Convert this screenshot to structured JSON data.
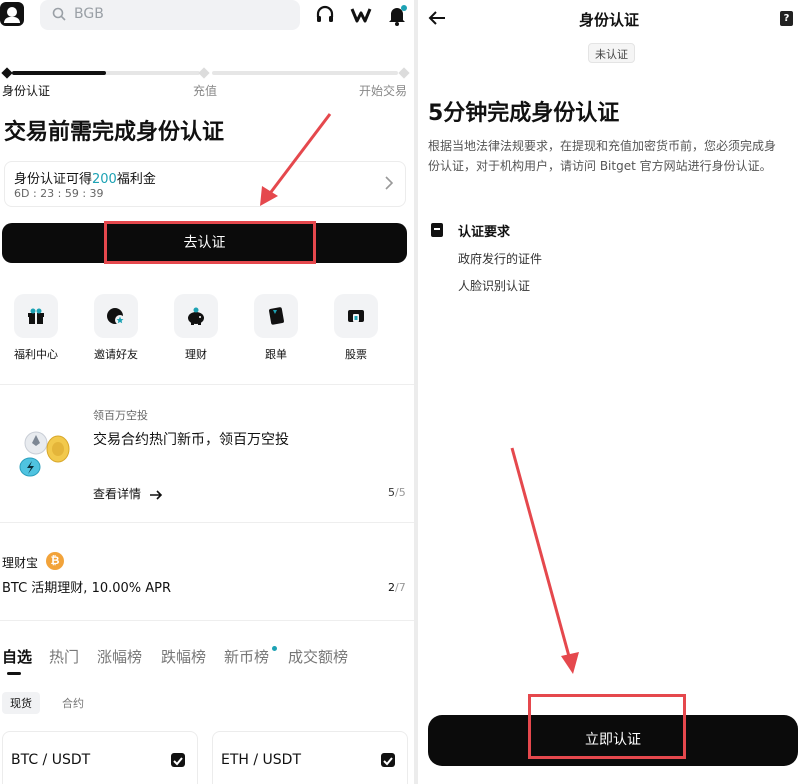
{
  "left": {
    "search_placeholder": "BGB",
    "progress": {
      "steps": [
        "身份认证",
        "充值",
        "开始交易"
      ]
    },
    "heading": "交易前需完成身份认证",
    "bonus": {
      "text_prefix": "身份认证可得",
      "amount": "200",
      "text_suffix": "福利金",
      "countdown": "6D : 23 : 59 : 39"
    },
    "go_verify_label": "去认证",
    "quick_actions": [
      "福利中心",
      "邀请好友",
      "理财",
      "跟单",
      "股票"
    ],
    "promo": {
      "subtitle": "领百万空投",
      "title": "交易合约热门新币，领百万空投",
      "link": "查看详情",
      "page_current": "5",
      "page_total": "/5"
    },
    "earn": {
      "label": "理财宝",
      "coin_symbol": "₿",
      "title": "BTC 活期理财, 10.00% APR",
      "page_current": "2",
      "page_total": "/7"
    },
    "market_tabs": [
      "自选",
      "热门",
      "涨幅榜",
      "跌幅榜",
      "新币榜",
      "成交额榜"
    ],
    "sub_tabs": [
      "现货",
      "合约"
    ],
    "pairs": [
      "BTC / USDT",
      "ETH / USDT"
    ]
  },
  "right": {
    "title": "身份认证",
    "help_glyph": "?",
    "status_badge": "未认证",
    "heading": "5分钟完成身份认证",
    "description": "根据当地法律法规要求，在提现和充值加密货币前，您必须完成身份认证，对于机构用户，请访问 Bitget 官方网站进行身份认证。",
    "requirements_title": "认证要求",
    "requirements": [
      "政府发行的证件",
      "人脸识别认证"
    ],
    "verify_now_label": "立即认证"
  },
  "colors": {
    "accent": "#1da2b4",
    "annotation": "#e5484d",
    "primary_button": "#0b0b0b"
  }
}
